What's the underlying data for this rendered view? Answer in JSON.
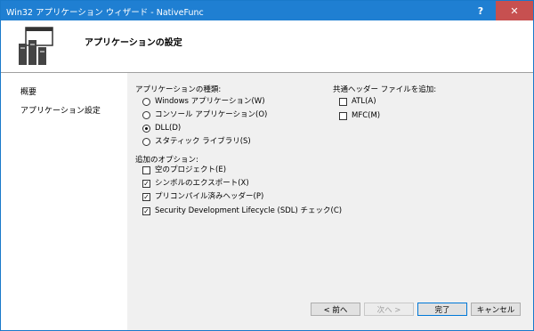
{
  "window": {
    "title": "Win32 アプリケーション ウィザード - NativeFunc",
    "help_label": "?",
    "close_label": "✕"
  },
  "header": {
    "title": "アプリケーションの設定"
  },
  "sidebar": {
    "items": [
      {
        "label": "概要"
      },
      {
        "label": "アプリケーション設定"
      }
    ]
  },
  "app_type": {
    "label": "アプリケーションの種類:",
    "options": [
      {
        "label": "Windows アプリケーション(W)",
        "checked": false
      },
      {
        "label": "コンソール アプリケーション(O)",
        "checked": false
      },
      {
        "label": "DLL(D)",
        "checked": true
      },
      {
        "label": "スタティック ライブラリ(S)",
        "checked": false
      }
    ]
  },
  "additional": {
    "label": "追加のオプション:",
    "options": [
      {
        "label": "空のプロジェクト(E)",
        "checked": false
      },
      {
        "label": "シンボルのエクスポート(X)",
        "checked": true
      },
      {
        "label": "プリコンパイル済みヘッダー(P)",
        "checked": true
      },
      {
        "label": "Security Development Lifecycle (SDL) チェック(C)",
        "checked": true
      }
    ]
  },
  "common_headers": {
    "label": "共通ヘッダー ファイルを追加:",
    "options": [
      {
        "label": "ATL(A)",
        "checked": false
      },
      {
        "label": "MFC(M)",
        "checked": false
      }
    ]
  },
  "buttons": {
    "prev": "< 前へ",
    "next": "次へ >",
    "finish": "完了",
    "cancel": "キャンセル"
  },
  "colors": {
    "titlebar": "#1f7fd2",
    "close": "#c75050",
    "content_bg": "#f0f0f0"
  }
}
